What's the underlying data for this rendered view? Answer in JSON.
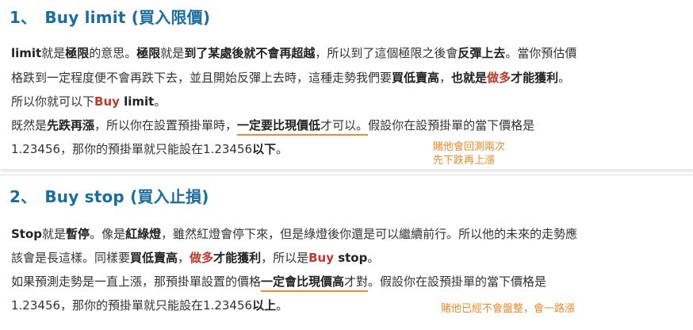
{
  "section1": {
    "number": "1、",
    "title": "Buy limit (買入限價)",
    "p1": [
      "limit",
      "就是",
      "極限",
      "的意思。",
      "極限",
      "就是",
      "到了某處後就不會再超越",
      "，所以到了這個極限之後會",
      "反彈上去",
      "。當你預估價"
    ],
    "p2": [
      "格跌到一定程度便不會再跌下去，並且開始反彈上去時，這種走勢我們要",
      "買低賣高",
      "，",
      "也就是",
      "做多",
      "才能獲利",
      "。"
    ],
    "p3": [
      "所以你就可以下",
      "Buy",
      " limit",
      "。"
    ],
    "p4": [
      "既然是",
      "先跌再漲",
      "，所以你在設置預掛單時，",
      "一定要比現價低",
      "才可以。",
      "假設你在設預掛單的當下價格是"
    ],
    "p5": [
      "1.23456，那你的預掛單就只能設在1.23456",
      "以下",
      "。"
    ],
    "note_line1": "賭他會回測兩次",
    "note_line2": "先下跌再上漲"
  },
  "section2": {
    "number": "2、",
    "title": "Buy stop (買入止損)",
    "p1": [
      "Stop",
      "就是",
      "暫停",
      "。像是",
      "紅綠燈",
      "，雖然紅燈會停下來，但是綠燈後你還是可以繼續前行。所以他的未來的走勢應"
    ],
    "p2": [
      "該會是長這樣。同樣要",
      "買低賣高",
      "，",
      "做多",
      "才能獲利",
      "，所以是",
      "Buy",
      " stop",
      "。"
    ],
    "p3": [
      "如果預測走勢是一直上漲，那預掛單設置的價格",
      "一定會比現價高",
      "才對",
      "。假設你在設預掛單的當下價格是"
    ],
    "p4": [
      "1.23456，那你的預掛單就只能設在1.23456",
      "以上",
      "。"
    ],
    "note": "賭他已經不會盤整，會一路漲"
  },
  "colors": {
    "heading": "#1a6e9f",
    "emphasis_red": "#c0392b",
    "annotation_orange": "#f08a2b",
    "text": "#333333"
  }
}
